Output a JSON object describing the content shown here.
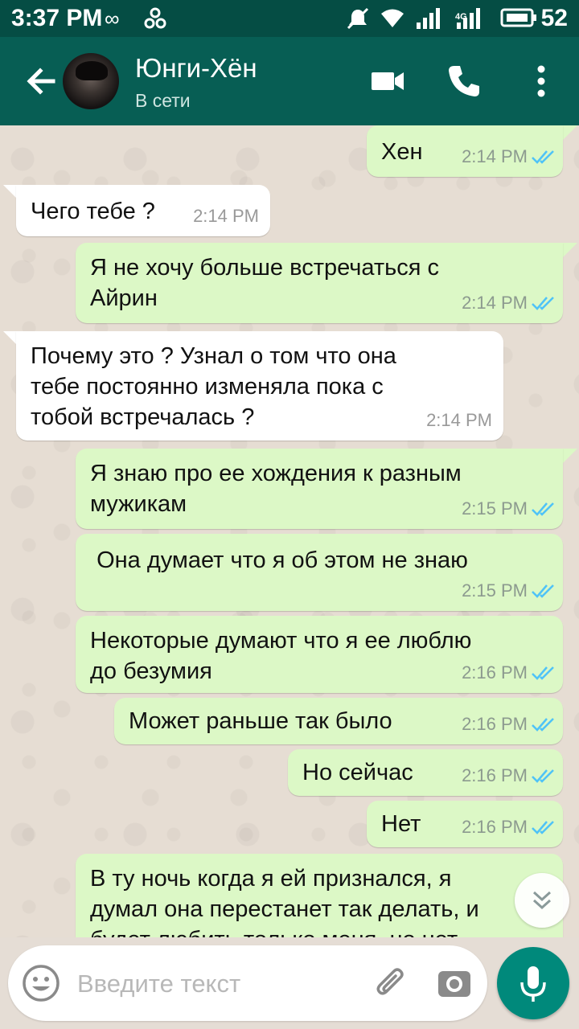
{
  "status_bar": {
    "time": "3:37 PM",
    "network_label": "4G",
    "battery": "52",
    "icons": [
      "infinity-icon",
      "usb-icon",
      "mute-icon",
      "wifi-icon",
      "signal-icon",
      "signal-4g-icon",
      "battery-icon"
    ]
  },
  "header": {
    "contact_name": "Юнги-Хён",
    "contact_status": "В сети",
    "icons": [
      "back-arrow-icon",
      "video-call-icon",
      "phone-icon",
      "more-vert-icon"
    ]
  },
  "messages": [
    {
      "direction": "out",
      "text": "Хен",
      "time": "2:14 PM",
      "read": true
    },
    {
      "direction": "in",
      "text": "Чего тебе ?",
      "time": "2:14 PM"
    },
    {
      "direction": "out",
      "text": "Я не хочу больше встречаться с\nАйрин",
      "time": "2:14 PM",
      "read": true
    },
    {
      "direction": "in",
      "text": "Почему это ? Узнал о том что она\nтебе постоянно изменяла пока с\nтобой встречалась ?",
      "time": "2:14 PM"
    },
    {
      "direction": "out",
      "text": "Я знаю про ее хождения к разным\nмужикам",
      "time": "2:15 PM",
      "read": true
    },
    {
      "direction": "out",
      "text": " Она думает что я об этом не знаю",
      "time": "2:15 PM",
      "read": true
    },
    {
      "direction": "out",
      "text": "Некоторые думают что я ее люблю\nдо безумия",
      "time": "2:16 PM",
      "read": true
    },
    {
      "direction": "out",
      "text": "Может раньше так было",
      "time": "2:16 PM",
      "read": true
    },
    {
      "direction": "out",
      "text": "Но сейчас",
      "time": "2:16 PM",
      "read": true
    },
    {
      "direction": "out",
      "text": "Нет",
      "time": "2:16 PM",
      "read": true
    },
    {
      "direction": "out",
      "text": "В ту ночь когда я ей признался, я\nдумал она перестанет так делать, и\nбудет любить только меня, но нет",
      "time": "",
      "read": false
    }
  ],
  "input": {
    "placeholder": "Введите текст",
    "value": ""
  },
  "colors": {
    "header": "#075e54",
    "status_bar": "#054d44",
    "outgoing_bubble": "#dcf8c6",
    "incoming_bubble": "#ffffff",
    "read_tick": "#4fc3f7",
    "mic_button": "#00897b"
  }
}
